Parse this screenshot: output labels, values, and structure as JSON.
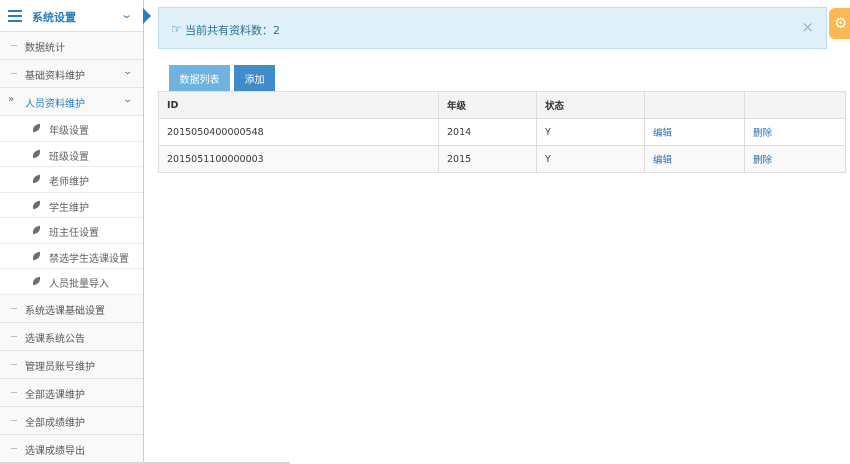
{
  "sidebar": {
    "header_title": "系统设置",
    "items": [
      {
        "label": "数据统计"
      },
      {
        "label": "基础资料维护"
      },
      {
        "label": "人员资料维护"
      }
    ],
    "subitems": [
      {
        "label": "年级设置"
      },
      {
        "label": "班级设置"
      },
      {
        "label": "老师维护"
      },
      {
        "label": "学生维护"
      },
      {
        "label": "班主任设置"
      },
      {
        "label": "禁选学生选课设置"
      },
      {
        "label": "人员批量导入"
      }
    ],
    "items_after": [
      {
        "label": "系统选课基础设置"
      },
      {
        "label": "选课系统公告"
      },
      {
        "label": "管理员账号维护"
      },
      {
        "label": "全部选课维护"
      },
      {
        "label": "全部成绩维护"
      },
      {
        "label": "选课成绩导出"
      }
    ],
    "open_marker": "»"
  },
  "alert": {
    "text": "当前共有资料数：2",
    "close": "×",
    "hand_icon": "hand-pointer-icon"
  },
  "toolbar": {
    "list_label": "数据列表",
    "add_label": "添加"
  },
  "table": {
    "headers": [
      "ID",
      "年级",
      "状态",
      "",
      ""
    ],
    "rows": [
      {
        "id": "2015050400000548",
        "grade": "2014",
        "status": "Y",
        "edit": "编辑",
        "delete": "删除"
      },
      {
        "id": "2015051100000003",
        "grade": "2015",
        "status": "Y",
        "edit": "编辑",
        "delete": "删除"
      }
    ]
  },
  "colors": {
    "accent": "#2b7dbc",
    "alert_bg": "#dff0f8",
    "settings_tab": "#ffb752",
    "btn_light": "#6fb3e0",
    "btn_primary": "#428bca"
  }
}
